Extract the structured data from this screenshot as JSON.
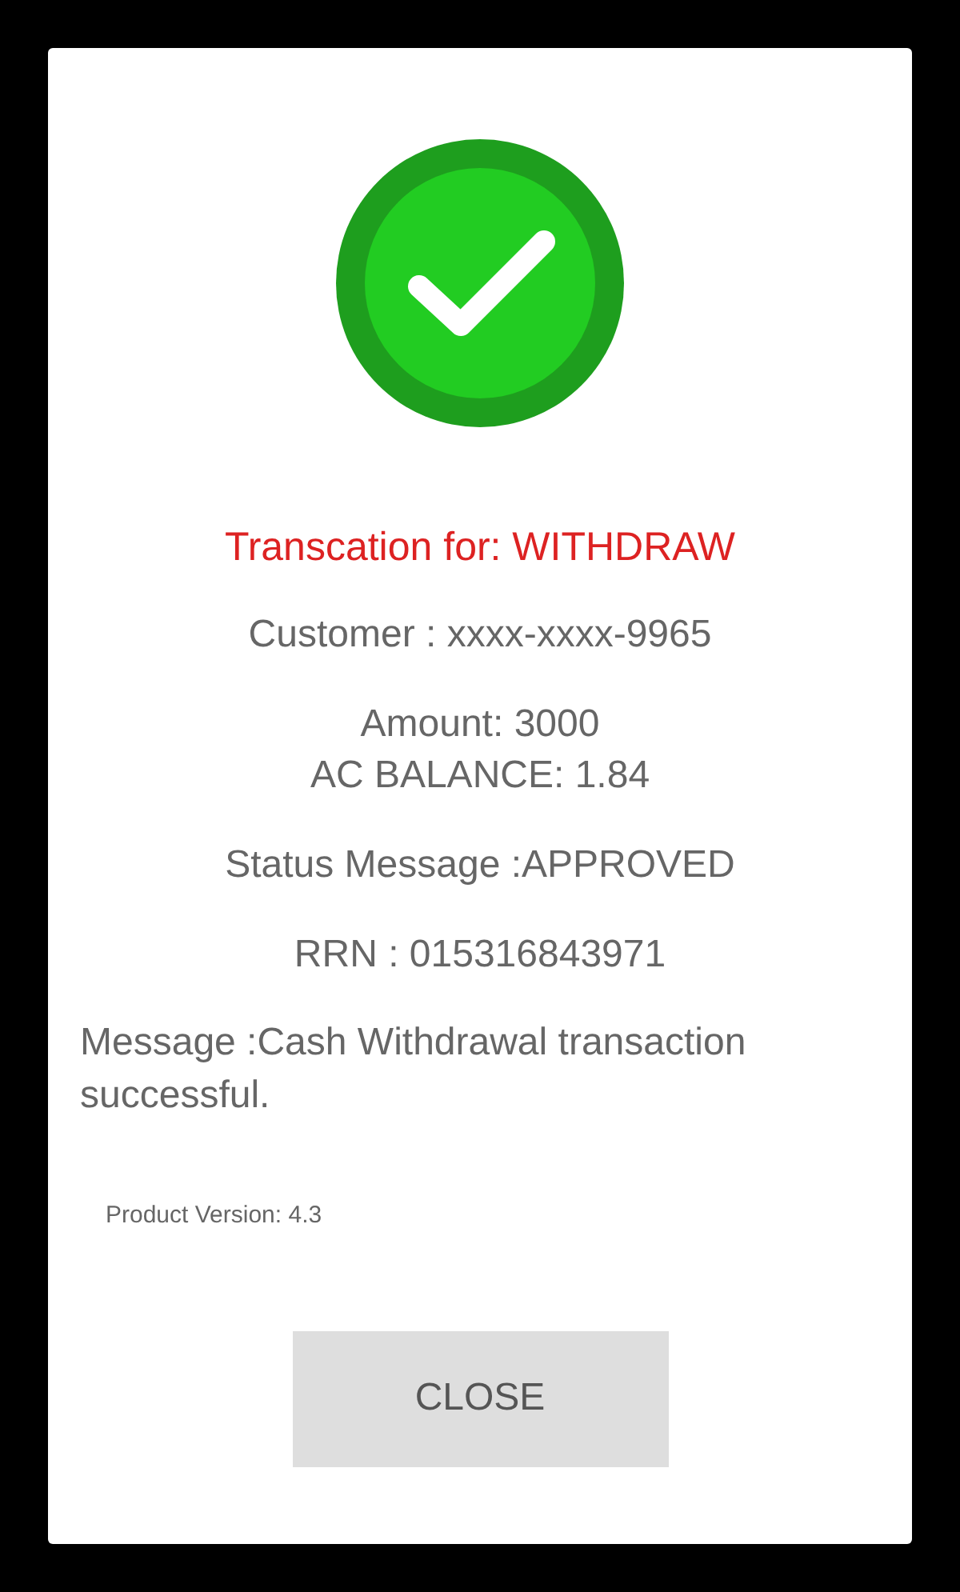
{
  "status": {
    "kind": "success"
  },
  "title": "Transcation for: WITHDRAW",
  "details": [
    {
      "lines": [
        "Customer : xxxx-xxxx-9965"
      ]
    },
    {
      "lines": [
        "Amount: 3000",
        "AC BALANCE: 1.84"
      ]
    },
    {
      "lines": [
        "Status Message :APPROVED"
      ]
    },
    {
      "lines": [
        "RRN : 015316843971"
      ]
    }
  ],
  "message": "Message :Cash Withdrawal transaction successful.",
  "product_version": "Product Version: 4.3",
  "close_button": "CLOSE"
}
